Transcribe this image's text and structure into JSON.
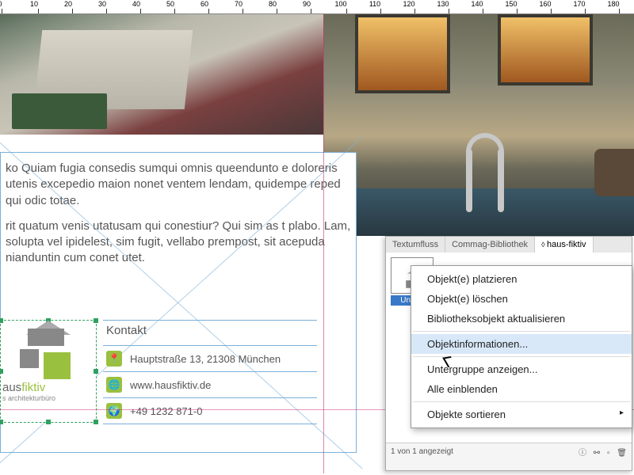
{
  "ruler": {
    "ticks": [
      0,
      10,
      20,
      30,
      40,
      50,
      60,
      70,
      80,
      90,
      100,
      110,
      120,
      130,
      140,
      150,
      160,
      170,
      180
    ]
  },
  "document": {
    "p1": "ko Quiam fugia consedis sumqui omnis queendunto e doloreris utenis excepedio maion nonet ventem lendam, quidempe reped qui odic totae.",
    "p2": "rit quatum venis utatusam qui conestiur? Qui sim as t plabo. Lam, solupta vel ipidelest, sim fugit, vellabo prempost, sit acepuda nianduntin cum conet utet."
  },
  "logo": {
    "brand_a": "aus",
    "brand_b": "fiktiv",
    "sub": "s architekturbüro"
  },
  "kontakt": {
    "heading": "Kontakt",
    "address": "Hauptstraße 13, 21308 München",
    "web": "www.hausfiktiv.de",
    "phone": "+49 1232 871-0"
  },
  "library": {
    "tabs": [
      "Textumfluss",
      "Commag-Bibliothek",
      "haus-fiktiv"
    ],
    "active_tab": 2,
    "item_label": "Unben",
    "status": "1 von 1 angezeigt"
  },
  "context_menu": {
    "items": [
      {
        "label": "Objekt(e) platzieren"
      },
      {
        "label": "Objekt(e) löschen"
      },
      {
        "label": "Bibliotheksobjekt aktualisieren"
      },
      {
        "sep": true
      },
      {
        "label": "Objektinformationen...",
        "hl": true
      },
      {
        "sep": true
      },
      {
        "label": "Untergruppe anzeigen..."
      },
      {
        "label": "Alle einblenden"
      },
      {
        "sep": true
      },
      {
        "label": "Objekte sortieren",
        "sub": true
      }
    ]
  }
}
